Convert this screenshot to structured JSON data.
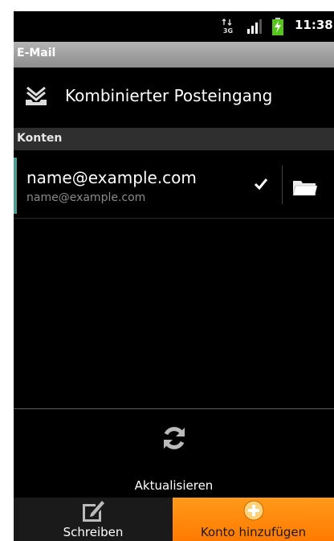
{
  "status_bar": {
    "network_label": "3G",
    "time": "11:38"
  },
  "titlebar": {
    "title": "E-Mail"
  },
  "combined_inbox": {
    "label": "Kombinierter Posteingang",
    "icon": "inbox-tray-icon"
  },
  "accounts_section": {
    "header": "Konten",
    "items": [
      {
        "name": "name@example.com",
        "email": "name@example.com",
        "check_icon": "checkmark-icon",
        "folder_icon": "folder-icon"
      }
    ]
  },
  "refresh": {
    "label": "Aktualisieren",
    "icon": "refresh-icon"
  },
  "bottom_tabs": [
    {
      "label": "Schreiben",
      "icon": "compose-icon"
    },
    {
      "label": "Konto hinzufügen",
      "icon": "add-circle-icon"
    }
  ],
  "colors": {
    "accent_teal": "#4a9e92",
    "active_tab_orange": "#ff8c00",
    "background": "#000000"
  }
}
